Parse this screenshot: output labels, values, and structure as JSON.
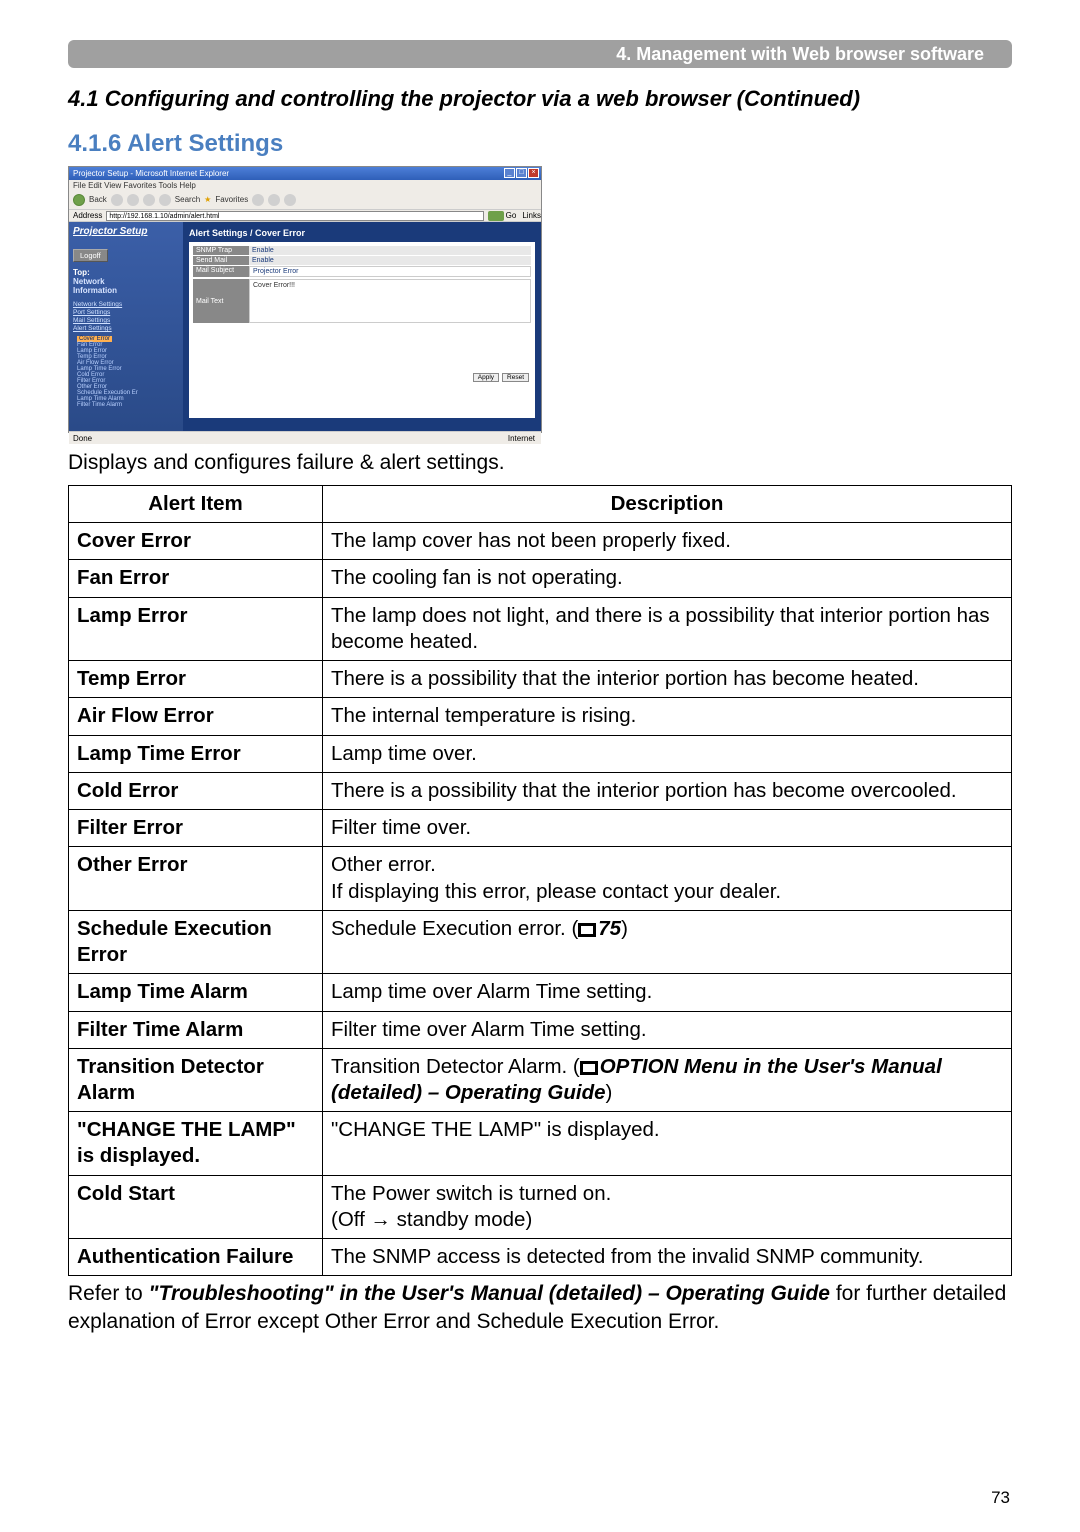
{
  "header": {
    "breadcrumb": "4. Management with Web browser software"
  },
  "section": {
    "title": "4.1 Configuring and controlling the projector via a web browser (Continued)"
  },
  "subsection": {
    "title": "4.1.6 Alert Settings"
  },
  "screenshot": {
    "window_title": "Projector Setup - Microsoft Internet Explorer",
    "menubar": "File  Edit  View  Favorites  Tools  Help",
    "toolbar_back": "Back",
    "toolbar_search": "Search",
    "toolbar_fav": "Favorites",
    "address_label": "Address",
    "address_value": "http://192.168.1.10/admin/alert.html",
    "go_label": "Go",
    "links_label": "Links",
    "sidebar": {
      "heading": "Projector Setup",
      "logoff": "Logoff",
      "top": "Top:",
      "network": "Network",
      "information": "Information",
      "links": [
        "Network Settings",
        "Port Settings",
        "Mail Settings",
        "Alert Settings"
      ],
      "sub": [
        "Cover Error",
        "Fan Error",
        "Lamp Error",
        "Temp Error",
        "Air Flow Error",
        "Lamp Time Error",
        "Cold Error",
        "Filter Error",
        "Other Error",
        "Schedule Execution Er",
        "Lamp Time Alarm",
        "Filter Time Alarm"
      ]
    },
    "panel": {
      "title": "Alert Settings / Cover Error",
      "rows": [
        {
          "label": "SNMP Trap",
          "value": "Enable"
        },
        {
          "label": "Send Mail",
          "value": "Enable"
        },
        {
          "label": "Mail Subject",
          "value": "Projector Error"
        }
      ],
      "mailtext_label": "Mail Text",
      "mailtext_value": "Cover Error!!!",
      "apply": "Apply",
      "reset": "Reset"
    },
    "statusbar": "Done",
    "statusbar_right": "Internet"
  },
  "intro": "Displays and configures failure & alert settings.",
  "table": {
    "headers": [
      "Alert Item",
      "Description"
    ],
    "rows": [
      {
        "item": "Cover Error",
        "desc": "The lamp cover has not been properly fixed."
      },
      {
        "item": "Fan Error",
        "desc": "The cooling fan is not operating."
      },
      {
        "item": "Lamp Error",
        "desc": "The lamp does not light, and there is a possibility that interior portion has become heated."
      },
      {
        "item": "Temp Error",
        "desc": "There is a possibility that the interior portion has become heated."
      },
      {
        "item": "Air Flow Error",
        "desc": "The internal temperature is rising."
      },
      {
        "item": "Lamp Time Error",
        "desc": "Lamp time over."
      },
      {
        "item": "Cold Error",
        "desc": "There is a possibility that the interior portion has become overcooled."
      },
      {
        "item": "Filter Error",
        "desc": "Filter time over."
      },
      {
        "item": "Other Error",
        "desc": "Other error.\nIf displaying this error, please contact your dealer."
      },
      {
        "item": "Schedule Execution Error",
        "desc_plain": "Schedule Execution error. (",
        "ref": "75",
        "desc_suffix": ")"
      },
      {
        "item": "Lamp Time Alarm",
        "desc": "Lamp time over Alarm Time setting."
      },
      {
        "item": "Filter Time Alarm",
        "desc": "Filter time over Alarm Time setting."
      },
      {
        "item": "Transition Detector Alarm",
        "desc_plain": "Transition Detector Alarm. (",
        "italic_bold": "OPTION Menu in the User's Manual (detailed) – Operating Guide",
        "desc_suffix": ")"
      },
      {
        "item": "\"CHANGE THE LAMP\" is displayed.",
        "desc": "\"CHANGE THE LAMP\" is displayed."
      },
      {
        "item": "Cold Start",
        "desc": "The Power switch is turned on.\n(Off → standby mode)"
      },
      {
        "item": "Authentication Failure",
        "desc": "The SNMP access is detected from the invalid SNMP community."
      }
    ]
  },
  "footer": {
    "prefix": "Refer to ",
    "italic_bold": "\"Troubleshooting\" in the User's Manual (detailed) – Operating Guide",
    "suffix": " for further detailed explanation of Error except Other Error and Schedule Execution Error."
  },
  "page_number": "73"
}
